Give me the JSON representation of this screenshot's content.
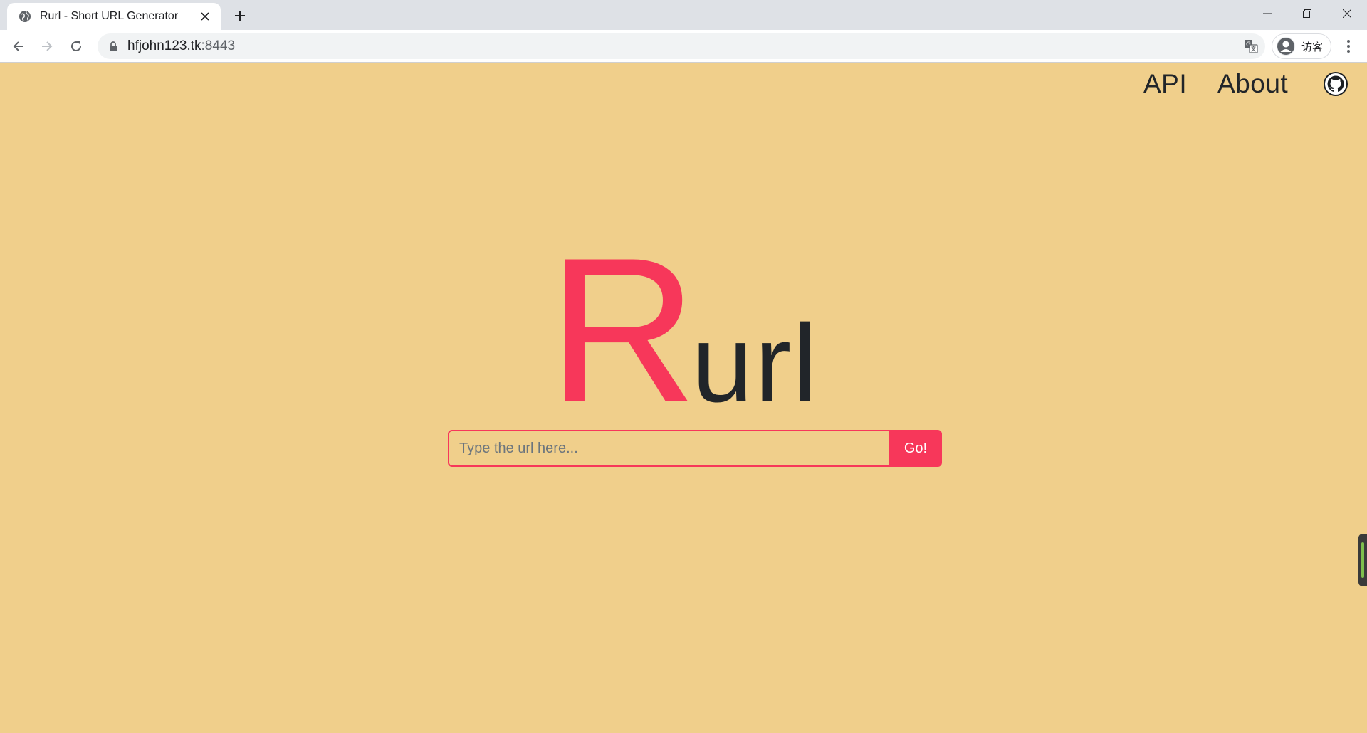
{
  "browser": {
    "tab_title": "Rurl - Short URL Generator",
    "url_host": "hfjohn123.tk",
    "url_port": ":8443",
    "profile_label": "访客"
  },
  "nav": {
    "api_label": "API",
    "about_label": "About"
  },
  "logo": {
    "first_letter": "R",
    "rest": "url"
  },
  "form": {
    "input_placeholder": "Type the url here...",
    "input_value": "",
    "go_label": "Go!"
  },
  "colors": {
    "background": "#f0cf8b",
    "accent": "#f7375a",
    "text_dark": "#212529"
  },
  "icons": {
    "tab_favicon": "globe-icon",
    "tab_close": "close-icon",
    "new_tab": "plus-icon",
    "back": "arrow-left-icon",
    "forward": "arrow-right-icon",
    "reload": "reload-icon",
    "lock": "lock-icon",
    "translate": "translate-icon",
    "menu": "more-vert-icon",
    "github": "github-icon"
  }
}
